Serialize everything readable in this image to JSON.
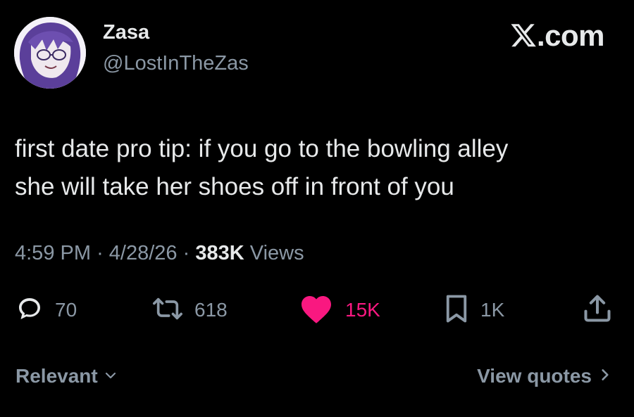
{
  "tweet": {
    "author": {
      "name": "Zasa",
      "handle": "@LostInTheZas",
      "avatar_icon": "avatar-anime-character"
    },
    "brand": {
      "text": ".com",
      "icon": "x-logo-icon"
    },
    "text_lines": [
      "first date pro tip: if you go to the bowling alley",
      "she will take her shoes off in front of you"
    ],
    "meta": {
      "time": "4:59 PM",
      "separator": "·",
      "date": "4/28/26",
      "views_count": "383K",
      "views_label": "Views"
    },
    "actions": {
      "replies": {
        "icon": "reply-icon",
        "count": "70"
      },
      "reposts": {
        "icon": "repost-icon",
        "count": "618"
      },
      "likes": {
        "icon": "heart-icon",
        "count": "15K",
        "active": true
      },
      "bookmarks": {
        "icon": "bookmark-icon",
        "count": "1K"
      },
      "share": {
        "icon": "share-icon"
      }
    },
    "footer": {
      "sort_label": "Relevant",
      "quotes_label": "View quotes"
    }
  },
  "colors": {
    "background": "#000000",
    "text_primary": "#e7e9ea",
    "text_secondary": "#8b98a5",
    "like_active": "#f91880"
  }
}
